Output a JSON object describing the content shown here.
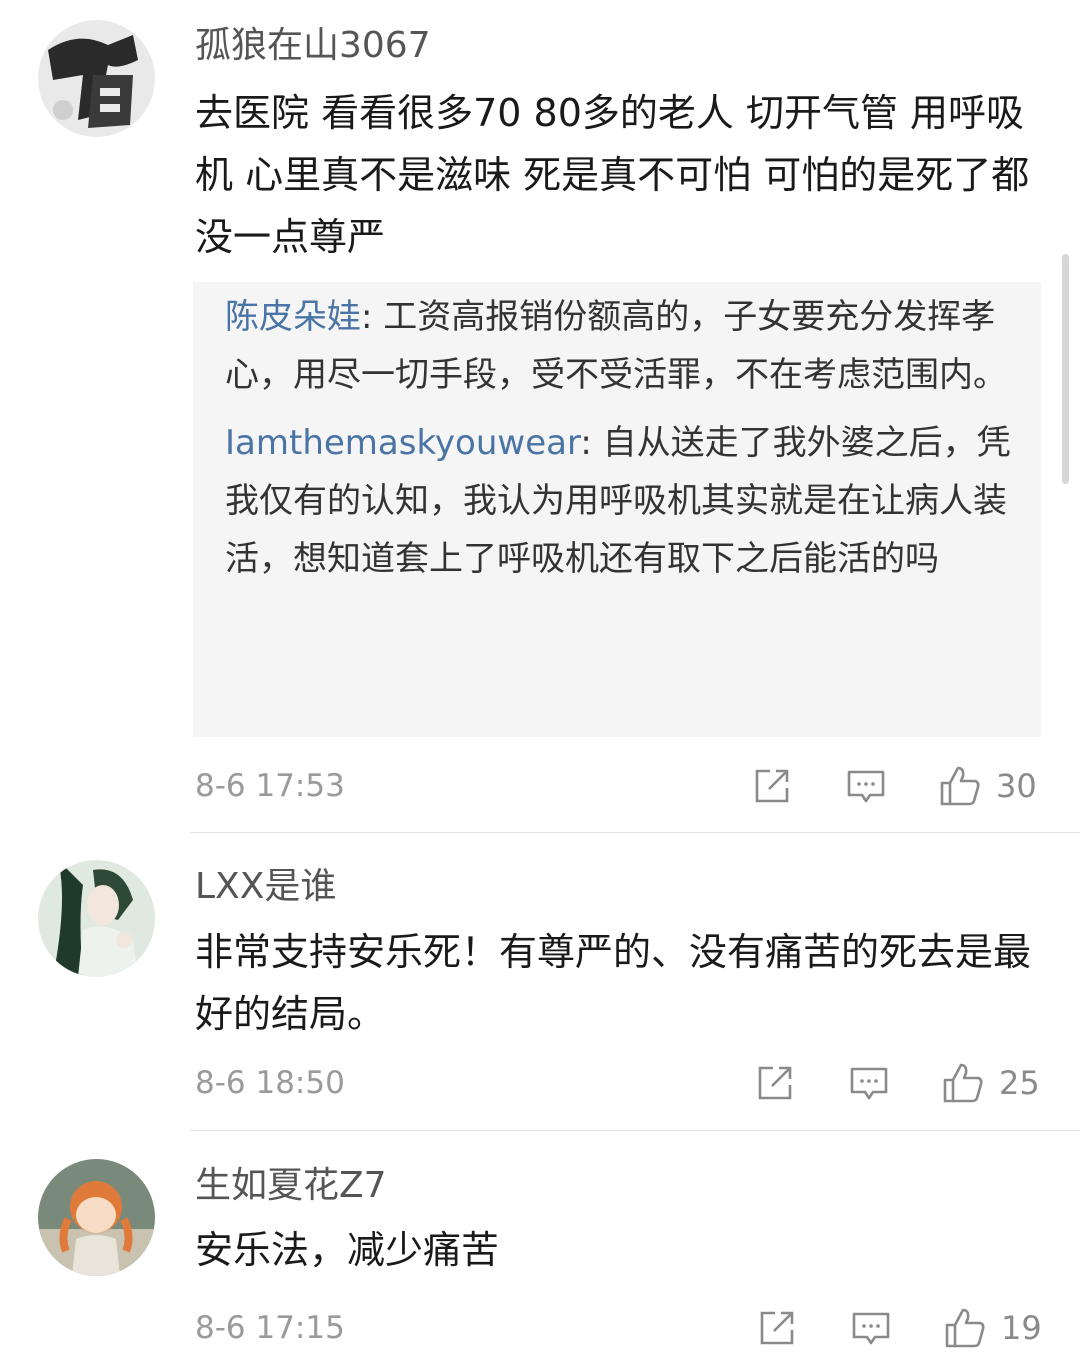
{
  "comments": [
    {
      "username": "孤狼在山3067",
      "avatar": "calligraphy-avatar",
      "body": "去医院 看看很多70 80多的老人 切开气管 用呼吸机 心里真不是滋味 死是真不可怕 可怕的是死了都没一点尊严",
      "replies": [
        {
          "user": "陈皮朵娃",
          "sep": ": ",
          "text": "工资高报销份额高的，子女要充分发挥孝心，用尽一切手段，受不受活罪，不在考虑范围内。"
        },
        {
          "user": "Iamthemaskyouwear",
          "sep": ": ",
          "text": "自从送走了我外婆之后，凭我仅有的认知，我认为用呼吸机其实就是在让病人装活，想知道套上了呼吸机还有取下之后能活的吗"
        }
      ],
      "time": "8-6 17:53",
      "likes": "30"
    },
    {
      "username": "LXX是谁",
      "avatar": "anime-girl-avatar",
      "body": "非常支持安乐死！有尊严的、没有痛苦的死去是最好的结局。",
      "time": "8-6 18:50",
      "likes": "25"
    },
    {
      "username": "生如夏花Z7",
      "avatar": "cartoon-girl-avatar",
      "body": "安乐法，减少痛苦",
      "time": "8-6 17:15",
      "likes": "19"
    }
  ],
  "icons": {
    "share": "share-icon",
    "comment": "comment-icon",
    "like": "like-icon"
  },
  "colors": {
    "reply_user": "#4a74a6",
    "reply_background": "#f5f5f5",
    "meta_text": "#9a9a9a"
  }
}
